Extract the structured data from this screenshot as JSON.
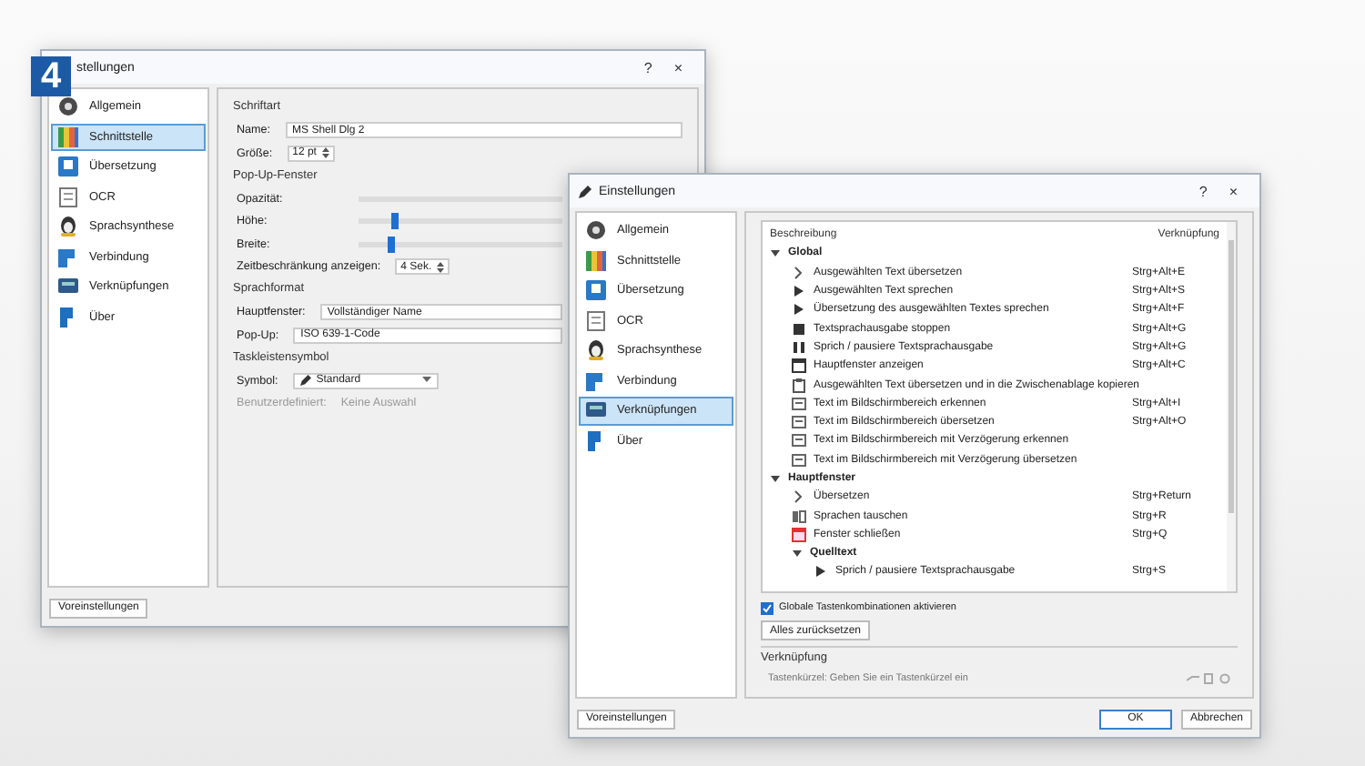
{
  "figure_badge": "4",
  "back_window": {
    "title": "stellungen",
    "help": "?",
    "close": "×",
    "sidebar": [
      {
        "label": "Allgemein",
        "kind": "general",
        "selected": false
      },
      {
        "label": "Schnittstelle",
        "kind": "interface",
        "selected": true
      },
      {
        "label": "Übersetzung",
        "kind": "translation",
        "selected": false
      },
      {
        "label": "OCR",
        "kind": "ocr",
        "selected": false
      },
      {
        "label": "Sprachsynthese",
        "kind": "speech",
        "selected": false
      },
      {
        "label": "Verbindung",
        "kind": "connection",
        "selected": false
      },
      {
        "label": "Verknüpfungen",
        "kind": "shortcuts",
        "selected": false
      },
      {
        "label": "Über",
        "kind": "about",
        "selected": false
      }
    ],
    "sections": [
      {
        "title": "Schriftart",
        "rows": [
          {
            "kind": "combo",
            "label": "Name:",
            "value": "MS Shell Dlg 2",
            "disabled": false
          },
          {
            "kind": "spin",
            "label": "Größe:",
            "value": "12 pt",
            "disabled": false
          }
        ]
      },
      {
        "title": "Pop-Up-Fenster",
        "rows": [
          {
            "kind": "slider",
            "label": "Opazität:",
            "disabled": false
          },
          {
            "kind": "slider",
            "label": "Höhe:",
            "level": 0.16,
            "disabled": false
          },
          {
            "kind": "slider",
            "label": "Breite:",
            "level": 0.14,
            "disabled": false
          },
          {
            "kind": "spin",
            "label": "Zeitbeschränkung anzeigen:",
            "value": "4 Sek.",
            "disabled": false
          }
        ]
      },
      {
        "title": "Sprachformat",
        "rows": [
          {
            "kind": "combo",
            "label": "Hauptfenster:",
            "value": "Vollständiger Name",
            "disabled": false
          },
          {
            "kind": "combo",
            "label": "Pop-Up:",
            "value": "ISO 639-1-Code",
            "disabled": false
          }
        ]
      },
      {
        "title": "Taskleistensymbol",
        "rows": [
          {
            "kind": "icon-combo",
            "label": "Symbol:",
            "value": "Standard",
            "disabled": false
          },
          {
            "kind": "text",
            "label": "Benutzerdefiniert:",
            "value": "Keine Auswahl",
            "disabled": true
          }
        ]
      }
    ],
    "reset_button": "Voreinstellungen"
  },
  "front_window": {
    "title": "Einstellungen",
    "help": "?",
    "close": "×",
    "sidebar": [
      {
        "label": "Allgemein",
        "kind": "general",
        "selected": false
      },
      {
        "label": "Schnittstelle",
        "kind": "interface",
        "selected": false
      },
      {
        "label": "Übersetzung",
        "kind": "translation",
        "selected": false
      },
      {
        "label": "OCR",
        "kind": "ocr",
        "selected": false
      },
      {
        "label": "Sprachsynthese",
        "kind": "speech",
        "selected": false
      },
      {
        "label": "Verbindung",
        "kind": "connection",
        "selected": false
      },
      {
        "label": "Verknüpfungen",
        "kind": "shortcuts",
        "selected": true
      },
      {
        "label": "Über",
        "kind": "about",
        "selected": false
      }
    ],
    "table": {
      "columns": [
        "Beschreibung",
        "Verknüpfung"
      ],
      "rows": [
        {
          "kind": "group",
          "label": "Global",
          "expanded": true,
          "children": [
            {
              "kind": "translate",
              "label": "Ausgewählten Text übersetzen",
              "shortcut": "Strg+Alt+E"
            },
            {
              "kind": "play",
              "label": "Ausgewählten Text sprechen",
              "shortcut": "Strg+Alt+S"
            },
            {
              "kind": "play",
              "label": "Übersetzung des ausgewählten Textes sprechen",
              "shortcut": "Strg+Alt+F"
            },
            {
              "kind": "stop",
              "label": "Textsprachausgabe stoppen",
              "shortcut": "Strg+Alt+G"
            },
            {
              "kind": "pause",
              "label": "Sprich / pausiere Textsprachausgabe",
              "shortcut": "Strg+Alt+G"
            },
            {
              "kind": "window",
              "label": "Hauptfenster anzeigen",
              "shortcut": "Strg+Alt+C"
            },
            {
              "kind": "copy",
              "label": "Ausgewählten Text übersetzen und in die Zwischenablage kopieren"
            },
            {
              "kind": "ocr",
              "label": "Text im Bildschirmbereich erkennen",
              "shortcut": "Strg+Alt+I"
            },
            {
              "kind": "ocr",
              "label": "Text im Bildschirmbereich übersetzen",
              "shortcut": "Strg+Alt+O"
            },
            {
              "kind": "ocr",
              "label": "Text im Bildschirmbereich mit Verzögerung erkennen"
            },
            {
              "kind": "ocr",
              "label": "Text im Bildschirmbereich mit Verzögerung übersetzen"
            }
          ]
        },
        {
          "kind": "group",
          "label": "Hauptfenster",
          "expanded": true,
          "children": [
            {
              "kind": "translate",
              "label": "Übersetzen",
              "shortcut": "Strg+Return"
            },
            {
              "kind": "swap",
              "label": "Sprachen tauschen",
              "shortcut": "Strg+R"
            },
            {
              "kind": "close",
              "label": "Fenster schließen",
              "shortcut": "Strg+Q"
            },
            {
              "kind": "group",
              "label": "Quelltext",
              "expanded": true,
              "children": [
                {
                  "kind": "play",
                  "label": "Sprich / pausiere Textsprachausgabe",
                  "shortcut": "Strg+S"
                }
              ]
            }
          ]
        }
      ]
    },
    "global_shortcuts": {
      "label": "Globale Tastenkombinationen aktivieren",
      "checked": true
    },
    "reset_all_button": "Alles zurücksetzen",
    "shortcut_group": {
      "title": "Verknüpfung",
      "placeholder": "Tastenkürzel: Geben Sie ein Tastenkürzel ein"
    },
    "reset_button": "Voreinstellungen",
    "buttons": [
      {
        "label": "OK",
        "kind": "default"
      },
      {
        "label": "Abbrechen",
        "kind": "normal"
      }
    ]
  }
}
